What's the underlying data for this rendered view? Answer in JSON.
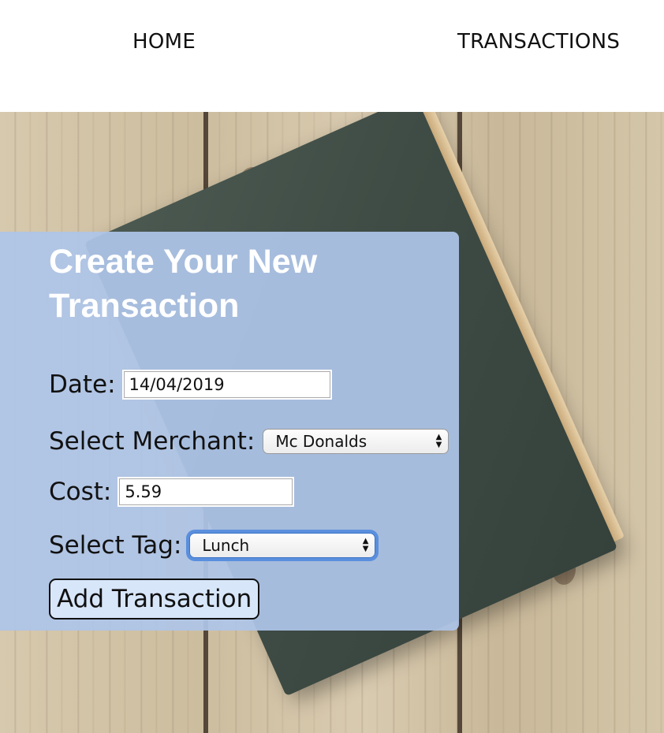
{
  "nav": {
    "home_label": "HOME",
    "transactions_label": "TRANSACTIONS"
  },
  "form": {
    "title": "Create Your New Transaction",
    "date_label": "Date:",
    "date_value": "14/04/2019",
    "merchant_label": "Select Merchant:",
    "merchant_value": "Mc Donalds",
    "cost_label": "Cost:",
    "cost_value": "5.59",
    "tag_label": "Select Tag:",
    "tag_value": "Lunch",
    "submit_label": "Add Transaction"
  },
  "colors": {
    "panel_bg": "#AEC5E8",
    "title_text": "#FFFFFF",
    "focus_ring": "#5A8FDE"
  },
  "background": {
    "description_icon": "wooden-table-with-book"
  }
}
